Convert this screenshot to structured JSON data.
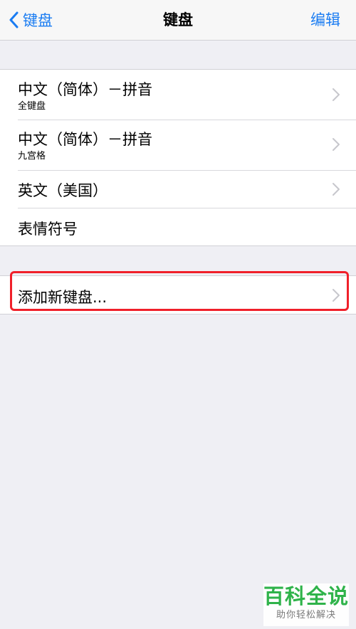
{
  "navbar": {
    "back_label": "键盘",
    "title": "键盘",
    "edit_label": "编辑"
  },
  "keyboards": [
    {
      "title": "中文（简体）－拼音",
      "subtitle": "全键盘"
    },
    {
      "title": "中文（简体）－拼音",
      "subtitle": "九宫格"
    },
    {
      "title": "英文（美国）"
    },
    {
      "title": "表情符号"
    }
  ],
  "add_keyboard": {
    "label": "添加新键盘..."
  },
  "watermark": {
    "main": "百科全说",
    "sub": "助你轻松解决"
  },
  "colors": {
    "accent": "#1a7cf2",
    "background": "#efeff4",
    "highlight": "#f0202a",
    "watermark_green": "#2fb34a"
  },
  "icons": {
    "back": "chevron-left-icon",
    "disclosure": "chevron-right-icon"
  }
}
